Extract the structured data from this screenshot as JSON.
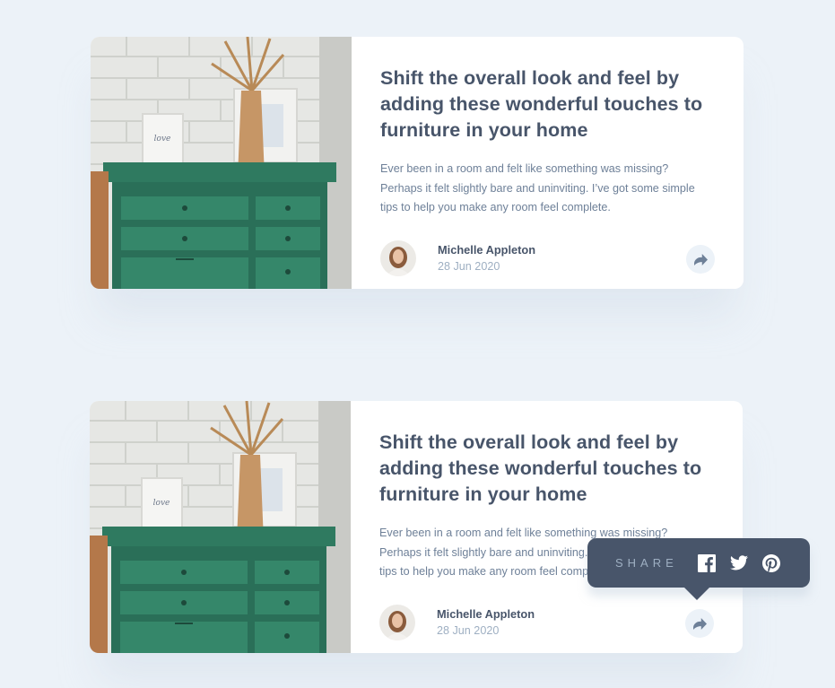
{
  "articles": [
    {
      "title": "Shift the overall look and feel by adding these wonderful touches to furniture in your home",
      "description": "Ever been in a room and felt like something was missing? Perhaps it felt slightly bare and uninviting. I’ve got some simple tips to help you make any room feel complete.",
      "author": {
        "name": "Michelle Appleton",
        "date": "28 Jun 2020"
      },
      "share_open": false
    },
    {
      "title": "Shift the overall look and feel by adding these wonderful touches to furniture in your home",
      "description": "Ever been in a room and felt like something was missing? Perhaps it felt slightly bare and uninviting. I’ve got some simple tips to help you make any room feel complete.",
      "author": {
        "name": "Michelle Appleton",
        "date": "28 Jun 2020"
      },
      "share_open": true
    }
  ],
  "share_tooltip": {
    "label": "SHARE",
    "icons": [
      "facebook-icon",
      "twitter-icon",
      "pinterest-icon"
    ]
  },
  "colors": {
    "background": "#ecf2f8",
    "title": "#48556a",
    "body": "#6e8098",
    "muted": "#9eafc2",
    "tooltip": "#48556a",
    "dresser": "#2f7a60"
  }
}
